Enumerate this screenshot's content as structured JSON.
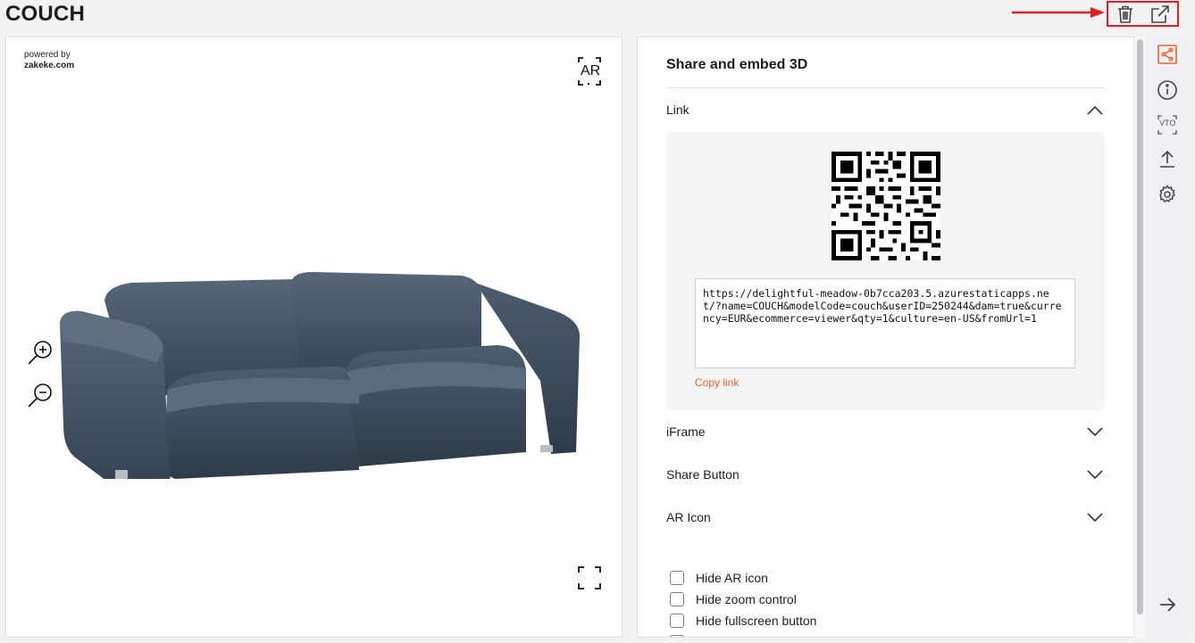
{
  "page": {
    "title": "COUCH"
  },
  "top_actions": [
    {
      "icon": "trash-icon"
    },
    {
      "icon": "external-link-icon"
    }
  ],
  "viewer": {
    "powered_by_line1": "powered by",
    "powered_by_line2": "zakeke.com",
    "ar_label": "AR",
    "controls": [
      "zoom-in-icon",
      "zoom-out-icon",
      "fullscreen-icon"
    ]
  },
  "panel": {
    "title": "Share and embed 3D",
    "sections": [
      {
        "label": "Link",
        "expanded": true
      },
      {
        "label": "iFrame",
        "expanded": false
      },
      {
        "label": "Share Button",
        "expanded": false
      },
      {
        "label": "AR Icon",
        "expanded": false
      }
    ],
    "link": {
      "url": "https://delightful-meadow-0b7cca203.5.azurestaticapps.net/?name=COUCH&modelCode=couch&userID=250244&dam=true&currency=EUR&ecommerce=viewer&qty=1&culture=en-US&fromUrl=1",
      "copy_label": "Copy link"
    },
    "checkboxes": [
      {
        "label": "Hide AR icon",
        "checked": false
      },
      {
        "label": "Hide zoom control",
        "checked": false
      },
      {
        "label": "Hide fullscreen button",
        "checked": false
      }
    ]
  },
  "side_rail": {
    "items": [
      "share-icon",
      "info-icon",
      "vto-icon",
      "upload-icon",
      "settings-icon"
    ],
    "footer": "arrow-right-icon",
    "vto_label": "VTO"
  },
  "colors": {
    "accent": "#f0612a",
    "highlight": "#e02020"
  }
}
